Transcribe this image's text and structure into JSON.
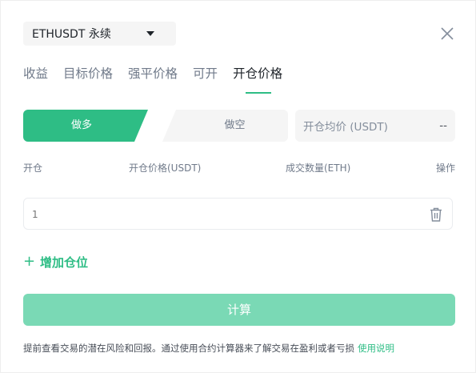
{
  "symbol": {
    "label": "ETHUSDT 永续",
    "icon": "caret-down-icon"
  },
  "close_icon": "close-icon",
  "tabs": [
    {
      "label": "收益",
      "active": false
    },
    {
      "label": "目标价格",
      "active": false
    },
    {
      "label": "强平价格",
      "active": false
    },
    {
      "label": "可开",
      "active": false
    },
    {
      "label": "开仓价格",
      "active": true
    }
  ],
  "direction": {
    "long_label": "做多",
    "short_label": "做空",
    "selected": "long"
  },
  "avg_price": {
    "label": "开仓均价 (USDT)",
    "value": "--"
  },
  "table": {
    "columns": [
      "开仓",
      "开仓价格(USDT)",
      "成交数量(ETH)",
      "操作"
    ],
    "rows": [
      {
        "index": "1",
        "price": "",
        "qty": ""
      }
    ]
  },
  "add_position_label": "增加仓位",
  "calc_label": "计算",
  "footer": {
    "text": "提前查看交易的潜在风险和回报。通过使用合约计算器来了解交易在盈利或者亏损",
    "link": "使用说明"
  },
  "colors": {
    "accent": "#2ebd85",
    "accent_disabled": "#7ad9b5",
    "text": "#1e2329",
    "muted": "#707a8a",
    "field_bg": "#f5f5f5"
  }
}
